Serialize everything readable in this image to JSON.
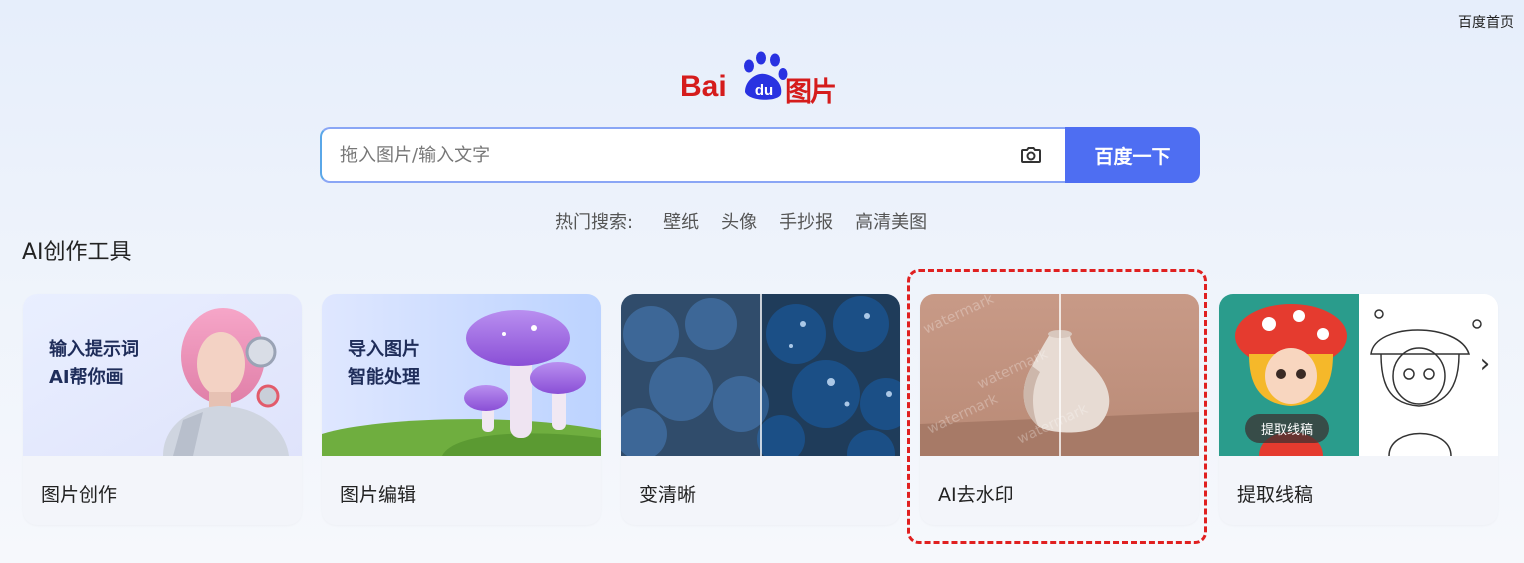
{
  "header": {
    "home_link": "百度首页"
  },
  "logo": {
    "text_bai": "Bai",
    "text_du": "du",
    "text_tupian": "图片",
    "brand_color": "#d51c1c",
    "paw_color": "#2932e1"
  },
  "search": {
    "placeholder": "拖入图片/输入文字",
    "value": "",
    "button_label": "百度一下",
    "camera_icon": "camera-icon",
    "accent": "#4e6ef2"
  },
  "hot_search": {
    "label": "热门搜索:",
    "items": [
      "壁纸",
      "头像",
      "手抄报",
      "高清美图"
    ]
  },
  "ai_tools": {
    "title": "AI创作工具",
    "cards": [
      {
        "label": "图片创作",
        "overlay": "输入提示词\nAI帮你画"
      },
      {
        "label": "图片编辑",
        "overlay": "导入图片\n智能处理"
      },
      {
        "label": "变清晰"
      },
      {
        "label": "AI去水印",
        "watermark_text": "watermark"
      },
      {
        "label": "提取线稿",
        "badge": "提取线稿",
        "next_icon": "chevron-right-icon"
      }
    ]
  },
  "annotation": {
    "highlight_color": "#e02020"
  }
}
